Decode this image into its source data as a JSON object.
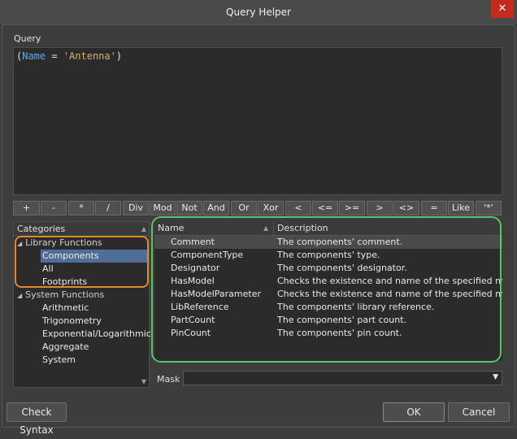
{
  "window": {
    "title": "Query Helper",
    "close_label": "✕"
  },
  "query": {
    "label": "Query",
    "tokens": {
      "open": "(",
      "field": "Name",
      "op": " = ",
      "value": "'Antenna'",
      "close": ")"
    }
  },
  "operators": [
    "+",
    "-",
    "*",
    "/",
    "Div",
    "Mod",
    "Not",
    "And",
    "Or",
    "Xor",
    "<",
    "<=",
    ">=",
    ">",
    "<>",
    "=",
    "Like",
    "'*'"
  ],
  "categories": {
    "header": "Categories",
    "items": [
      {
        "label": "Library Functions",
        "level": 0
      },
      {
        "label": "Components",
        "level": 1
      },
      {
        "label": "All",
        "level": 1
      },
      {
        "label": "Footprints",
        "level": 1
      },
      {
        "label": "System Functions",
        "level": 0
      },
      {
        "label": "Arithmetic",
        "level": 1
      },
      {
        "label": "Trigonometry",
        "level": 1
      },
      {
        "label": "Exponential/Logarithmic",
        "level": 1
      },
      {
        "label": "Aggregate",
        "level": 1
      },
      {
        "label": "System",
        "level": 1
      }
    ]
  },
  "functions": {
    "col_name": "Name",
    "col_desc": "Description",
    "rows": [
      {
        "name": "Comment",
        "desc": "The components' comment."
      },
      {
        "name": "ComponentType",
        "desc": "The components' type."
      },
      {
        "name": "Designator",
        "desc": "The components' designator."
      },
      {
        "name": "HasModel",
        "desc": "Checks the existence and name of the specified mode"
      },
      {
        "name": "HasModelParameter",
        "desc": "Checks the existence and name of the specified mode"
      },
      {
        "name": "LibReference",
        "desc": "The components' library reference."
      },
      {
        "name": "PartCount",
        "desc": "The components' part count."
      },
      {
        "name": "PinCount",
        "desc": "The components' pin count."
      }
    ]
  },
  "mask": {
    "label": "Mask",
    "value": ""
  },
  "buttons": {
    "check_syntax": "Check Syntax",
    "ok": "OK",
    "cancel": "Cancel"
  },
  "colors": {
    "highlight_orange": "#e4882c",
    "highlight_green": "#5ac46a",
    "selection": "#4f6d96"
  }
}
